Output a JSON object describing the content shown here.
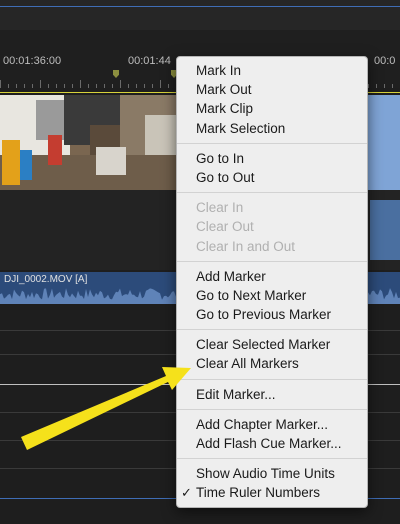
{
  "ruler": {
    "timecodes": [
      "00:01:36:00",
      "00:01:44",
      "00:0"
    ]
  },
  "audio_clip": {
    "name": "DJI_0002.MOV [A]"
  },
  "context_menu": {
    "groups": [
      [
        {
          "label": "Mark In",
          "enabled": true
        },
        {
          "label": "Mark Out",
          "enabled": true
        },
        {
          "label": "Mark Clip",
          "enabled": true
        },
        {
          "label": "Mark Selection",
          "enabled": true
        }
      ],
      [
        {
          "label": "Go to In",
          "enabled": true
        },
        {
          "label": "Go to Out",
          "enabled": true
        }
      ],
      [
        {
          "label": "Clear In",
          "enabled": false
        },
        {
          "label": "Clear Out",
          "enabled": false
        },
        {
          "label": "Clear In and Out",
          "enabled": false
        }
      ],
      [
        {
          "label": "Add Marker",
          "enabled": true
        },
        {
          "label": "Go to Next Marker",
          "enabled": true
        },
        {
          "label": "Go to Previous Marker",
          "enabled": true
        }
      ],
      [
        {
          "label": "Clear Selected Marker",
          "enabled": true
        },
        {
          "label": "Clear All Markers",
          "enabled": true
        }
      ],
      [
        {
          "label": "Edit Marker...",
          "enabled": true
        }
      ],
      [
        {
          "label": "Add Chapter Marker...",
          "enabled": true
        },
        {
          "label": "Add Flash Cue Marker...",
          "enabled": true
        }
      ],
      [
        {
          "label": "Show Audio Time Units",
          "enabled": true,
          "checked": false
        },
        {
          "label": "Time Ruler Numbers",
          "enabled": true,
          "checked": true
        }
      ]
    ],
    "check_glyph": "✓"
  },
  "annotation": {
    "arrow_color": "#f5e11b",
    "arrow_icon": "yellow-arrow-icon"
  },
  "colors": {
    "clip_blue": "#7fa4d6",
    "audio_blue": "#2c4b7a",
    "menu_bg": "#eeeeee",
    "disabled_text": "#b0b0b0"
  }
}
